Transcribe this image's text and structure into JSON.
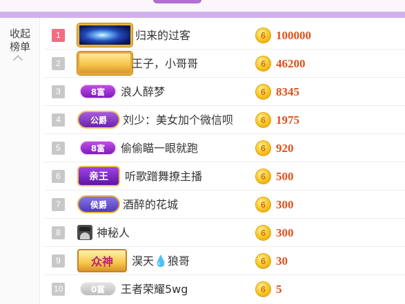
{
  "collapse": {
    "label": "收起榜单"
  },
  "rows": [
    {
      "rank": "1",
      "badge_text": "",
      "name": "归来的过客",
      "coin": "6",
      "score": "100000"
    },
    {
      "rank": "2",
      "badge_text": "",
      "name": "王子，小哥哥",
      "coin": "6",
      "score": "46200"
    },
    {
      "rank": "3",
      "badge_text": "8富",
      "name": "浪人醉梦",
      "coin": "6",
      "score": "8345"
    },
    {
      "rank": "4",
      "badge_text": "公爵",
      "name": "刘少：美女加个微信呗",
      "coin": "6",
      "score": "1975"
    },
    {
      "rank": "5",
      "badge_text": "8富",
      "name": "偷偷瞄一眼就跑",
      "coin": "6",
      "score": "920"
    },
    {
      "rank": "6",
      "badge_text": "亲王",
      "name": "听歌蹭舞撩主播",
      "coin": "6",
      "score": "500"
    },
    {
      "rank": "7",
      "badge_text": "侯爵",
      "name": "酒醉的花城",
      "coin": "6",
      "score": "300"
    },
    {
      "rank": "8",
      "badge_text": "",
      "name": "神秘人",
      "coin": "6",
      "score": "300"
    },
    {
      "rank": "9",
      "badge_text": "众神",
      "name": "淏天💧狼哥",
      "coin": "6",
      "score": "30"
    },
    {
      "rank": "10",
      "badge_text": "0富",
      "name": "王者荣耀5wg",
      "coin": "6",
      "score": "5"
    }
  ],
  "colors": {
    "accent_purple": "#d3b0e9",
    "score_orange": "#e0501a",
    "rank_top": "#f16d80",
    "rank_default": "#c8c8c8"
  },
  "icons": {
    "collapse": "chevron-up-icon",
    "coin": "coin-icon",
    "mystery": "mystery-user-icon"
  }
}
